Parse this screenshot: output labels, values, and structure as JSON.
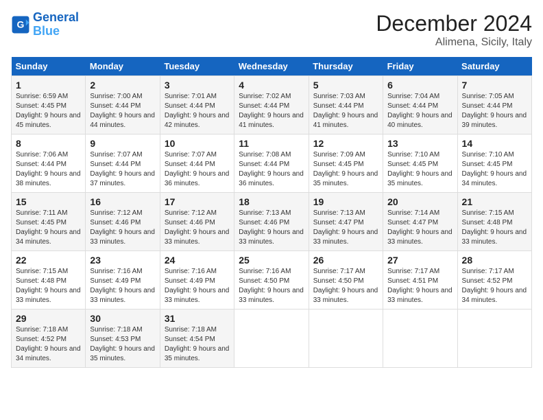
{
  "header": {
    "logo_line1": "General",
    "logo_line2": "Blue",
    "title": "December 2024",
    "subtitle": "Alimena, Sicily, Italy"
  },
  "weekdays": [
    "Sunday",
    "Monday",
    "Tuesday",
    "Wednesday",
    "Thursday",
    "Friday",
    "Saturday"
  ],
  "weeks": [
    [
      {
        "day": 1,
        "sunrise": "6:59 AM",
        "sunset": "4:45 PM",
        "daylight": "9 hours and 45 minutes."
      },
      {
        "day": 2,
        "sunrise": "7:00 AM",
        "sunset": "4:44 PM",
        "daylight": "9 hours and 44 minutes."
      },
      {
        "day": 3,
        "sunrise": "7:01 AM",
        "sunset": "4:44 PM",
        "daylight": "9 hours and 42 minutes."
      },
      {
        "day": 4,
        "sunrise": "7:02 AM",
        "sunset": "4:44 PM",
        "daylight": "9 hours and 41 minutes."
      },
      {
        "day": 5,
        "sunrise": "7:03 AM",
        "sunset": "4:44 PM",
        "daylight": "9 hours and 41 minutes."
      },
      {
        "day": 6,
        "sunrise": "7:04 AM",
        "sunset": "4:44 PM",
        "daylight": "9 hours and 40 minutes."
      },
      {
        "day": 7,
        "sunrise": "7:05 AM",
        "sunset": "4:44 PM",
        "daylight": "9 hours and 39 minutes."
      }
    ],
    [
      {
        "day": 8,
        "sunrise": "7:06 AM",
        "sunset": "4:44 PM",
        "daylight": "9 hours and 38 minutes."
      },
      {
        "day": 9,
        "sunrise": "7:07 AM",
        "sunset": "4:44 PM",
        "daylight": "9 hours and 37 minutes."
      },
      {
        "day": 10,
        "sunrise": "7:07 AM",
        "sunset": "4:44 PM",
        "daylight": "9 hours and 36 minutes."
      },
      {
        "day": 11,
        "sunrise": "7:08 AM",
        "sunset": "4:44 PM",
        "daylight": "9 hours and 36 minutes."
      },
      {
        "day": 12,
        "sunrise": "7:09 AM",
        "sunset": "4:45 PM",
        "daylight": "9 hours and 35 minutes."
      },
      {
        "day": 13,
        "sunrise": "7:10 AM",
        "sunset": "4:45 PM",
        "daylight": "9 hours and 35 minutes."
      },
      {
        "day": 14,
        "sunrise": "7:10 AM",
        "sunset": "4:45 PM",
        "daylight": "9 hours and 34 minutes."
      }
    ],
    [
      {
        "day": 15,
        "sunrise": "7:11 AM",
        "sunset": "4:45 PM",
        "daylight": "9 hours and 34 minutes."
      },
      {
        "day": 16,
        "sunrise": "7:12 AM",
        "sunset": "4:46 PM",
        "daylight": "9 hours and 33 minutes."
      },
      {
        "day": 17,
        "sunrise": "7:12 AM",
        "sunset": "4:46 PM",
        "daylight": "9 hours and 33 minutes."
      },
      {
        "day": 18,
        "sunrise": "7:13 AM",
        "sunset": "4:46 PM",
        "daylight": "9 hours and 33 minutes."
      },
      {
        "day": 19,
        "sunrise": "7:13 AM",
        "sunset": "4:47 PM",
        "daylight": "9 hours and 33 minutes."
      },
      {
        "day": 20,
        "sunrise": "7:14 AM",
        "sunset": "4:47 PM",
        "daylight": "9 hours and 33 minutes."
      },
      {
        "day": 21,
        "sunrise": "7:15 AM",
        "sunset": "4:48 PM",
        "daylight": "9 hours and 33 minutes."
      }
    ],
    [
      {
        "day": 22,
        "sunrise": "7:15 AM",
        "sunset": "4:48 PM",
        "daylight": "9 hours and 33 minutes."
      },
      {
        "day": 23,
        "sunrise": "7:16 AM",
        "sunset": "4:49 PM",
        "daylight": "9 hours and 33 minutes."
      },
      {
        "day": 24,
        "sunrise": "7:16 AM",
        "sunset": "4:49 PM",
        "daylight": "9 hours and 33 minutes."
      },
      {
        "day": 25,
        "sunrise": "7:16 AM",
        "sunset": "4:50 PM",
        "daylight": "9 hours and 33 minutes."
      },
      {
        "day": 26,
        "sunrise": "7:17 AM",
        "sunset": "4:50 PM",
        "daylight": "9 hours and 33 minutes."
      },
      {
        "day": 27,
        "sunrise": "7:17 AM",
        "sunset": "4:51 PM",
        "daylight": "9 hours and 33 minutes."
      },
      {
        "day": 28,
        "sunrise": "7:17 AM",
        "sunset": "4:52 PM",
        "daylight": "9 hours and 34 minutes."
      }
    ],
    [
      {
        "day": 29,
        "sunrise": "7:18 AM",
        "sunset": "4:52 PM",
        "daylight": "9 hours and 34 minutes."
      },
      {
        "day": 30,
        "sunrise": "7:18 AM",
        "sunset": "4:53 PM",
        "daylight": "9 hours and 35 minutes."
      },
      {
        "day": 31,
        "sunrise": "7:18 AM",
        "sunset": "4:54 PM",
        "daylight": "9 hours and 35 minutes."
      },
      null,
      null,
      null,
      null
    ]
  ]
}
